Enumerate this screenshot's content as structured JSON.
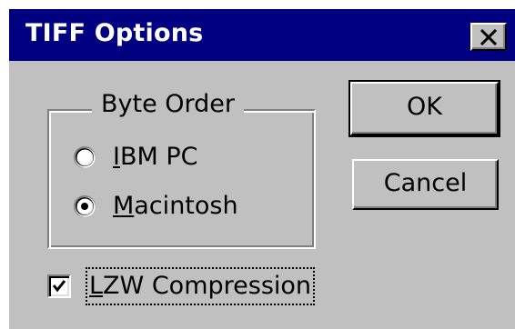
{
  "dialog": {
    "title": "TIFF Options",
    "close_icon": "close-icon"
  },
  "byte_order": {
    "label": "Byte Order",
    "options": [
      {
        "label": "IBM PC",
        "selected": false
      },
      {
        "label": "Macintosh",
        "selected": true
      }
    ]
  },
  "buttons": {
    "ok_label": "OK",
    "cancel_label": "Cancel"
  },
  "compression": {
    "label": "LZW Compression",
    "checked": true
  },
  "colors": {
    "titlebar": "#000080",
    "face": "#c0c0c0"
  }
}
